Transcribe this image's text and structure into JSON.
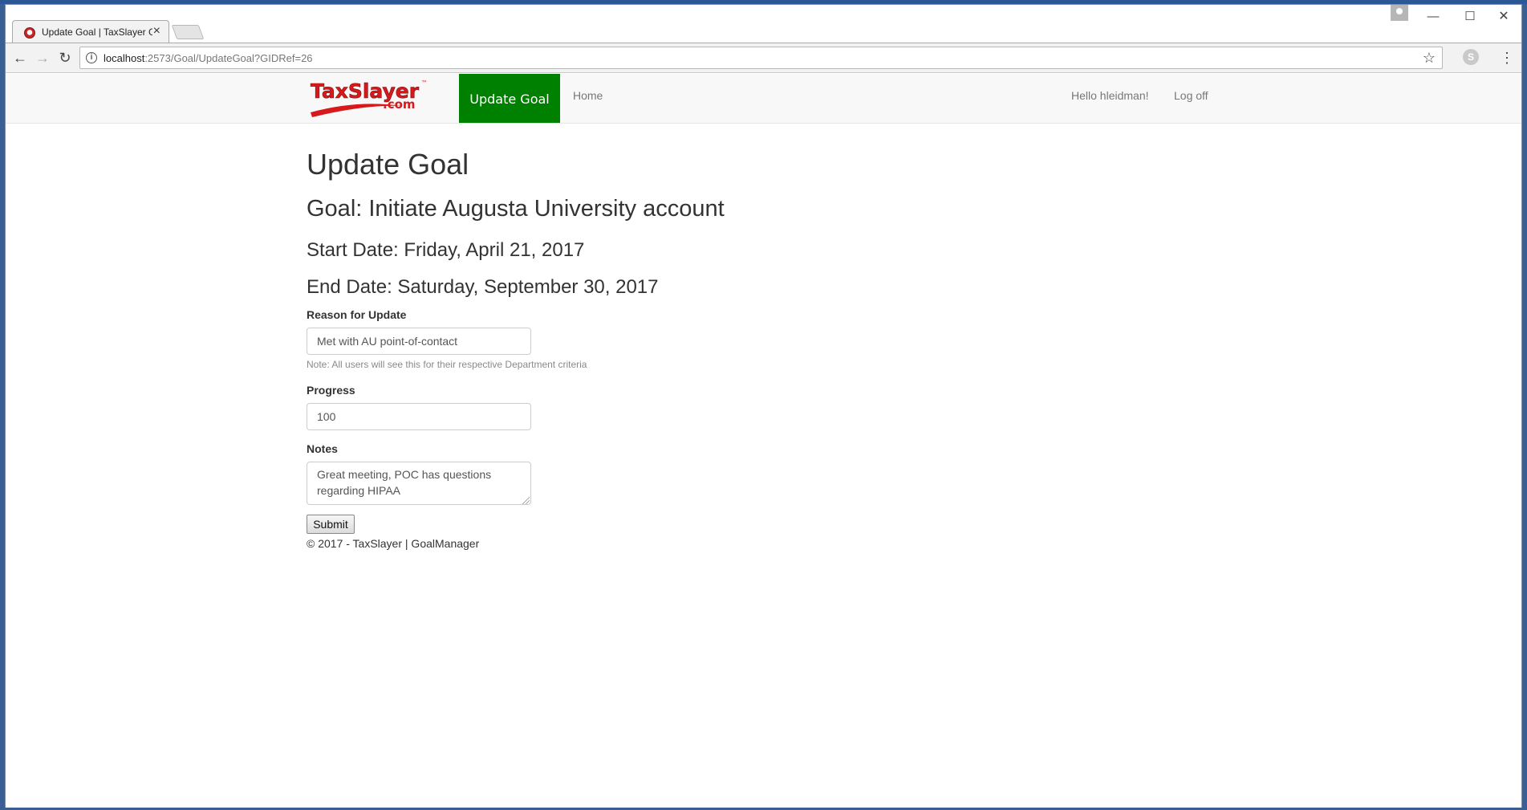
{
  "browser": {
    "tab_title": "Update Goal | TaxSlayer GoalManager",
    "tab_close": "×",
    "url_host": "localhost",
    "url_path": ":2573/Goal/UpdateGoal?GIDRef=26",
    "window_controls": {
      "minimize": "—",
      "maximize": "☐",
      "close": "✕"
    },
    "nav": {
      "back": "←",
      "forward": "→",
      "reload": "↻"
    },
    "star": "☆",
    "menu": "⋮",
    "extension_letter": "S"
  },
  "navbar": {
    "brand_main": "TaxSlayer",
    "brand_tm": "™",
    "brand_sub": ".com",
    "active_item": "Update Goal",
    "home": "Home",
    "greeting": "Hello hleidman!",
    "logoff": "Log off"
  },
  "page": {
    "title": "Update Goal",
    "goal": "Goal: Initiate Augusta University account",
    "start_date": "Start Date: Friday, April 21, 2017",
    "end_date": "End Date: Saturday, September 30, 2017"
  },
  "form": {
    "reason_label": "Reason for Update",
    "reason_value": "Met with AU point-of-contact",
    "reason_help": "Note: All users will see this for their respective Department criteria",
    "progress_label": "Progress",
    "progress_value": "100",
    "notes_label": "Notes",
    "notes_value": "Great meeting, POC has questions regarding HIPAA",
    "submit_label": "Submit"
  },
  "footer": {
    "text": "© 2017 - TaxSlayer | GoalManager"
  },
  "colors": {
    "nav_active_bg": "#008000",
    "brand_red": "#d7191c"
  }
}
